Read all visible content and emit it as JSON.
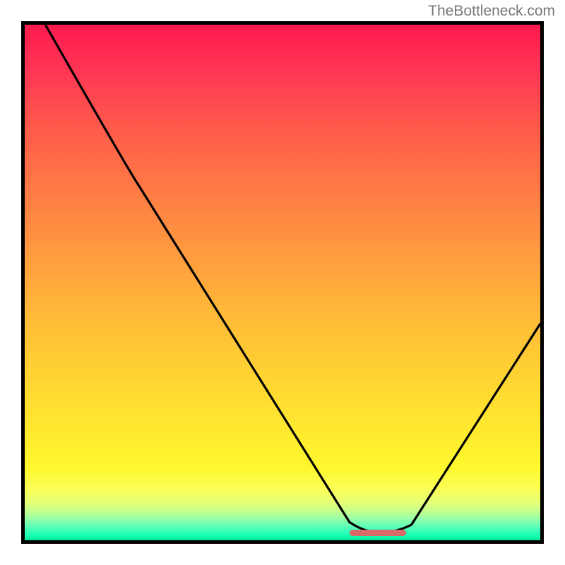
{
  "attribution": "TheBottleneck.com",
  "chart_data": {
    "type": "line",
    "title": "",
    "xlabel": "",
    "ylabel": "",
    "xlim": [
      0,
      100
    ],
    "ylim": [
      0,
      100
    ],
    "curve_points": [
      {
        "x": 4,
        "y": 100
      },
      {
        "x": 20,
        "y": 72
      },
      {
        "x": 24,
        "y": 66
      },
      {
        "x": 63,
        "y": 3.5
      },
      {
        "x": 66,
        "y": 1.5
      },
      {
        "x": 72,
        "y": 1.5
      },
      {
        "x": 75,
        "y": 3
      },
      {
        "x": 100,
        "y": 42
      }
    ],
    "optimal_marker": {
      "x_start": 63,
      "x_end": 74,
      "y": 1.5
    },
    "gradient": {
      "top": "#ff1a4d",
      "mid_upper": "#ff9a3f",
      "mid_lower": "#ffe82f",
      "bottom": "#00e695"
    }
  }
}
